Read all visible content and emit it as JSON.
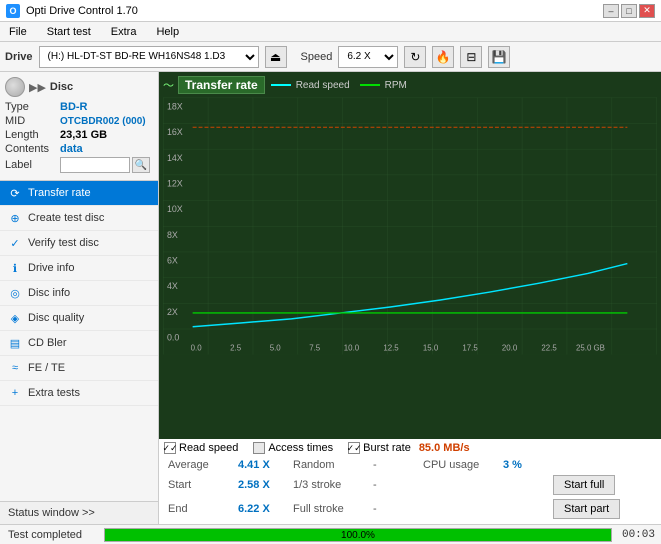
{
  "app": {
    "title": "Opti Drive Control 1.70",
    "icon": "O"
  },
  "title_controls": {
    "minimize": "–",
    "maximize": "□",
    "close": "✕"
  },
  "menu": {
    "items": [
      "File",
      "Start test",
      "Extra",
      "Help"
    ]
  },
  "toolbar": {
    "drive_label": "Drive",
    "drive_value": "(H:)  HL-DT-ST BD-RE  WH16NS48 1.D3",
    "speed_label": "Speed",
    "speed_value": "6.2 X"
  },
  "disc": {
    "section_label": "Disc",
    "type_label": "Type",
    "type_value": "BD-R",
    "mid_label": "MID",
    "mid_value": "OTCBDR002 (000)",
    "length_label": "Length",
    "length_value": "23,31 GB",
    "contents_label": "Contents",
    "contents_value": "data",
    "label_label": "Label",
    "label_placeholder": ""
  },
  "nav": {
    "items": [
      {
        "id": "transfer-rate",
        "label": "Transfer rate",
        "icon": "⟳",
        "active": true
      },
      {
        "id": "create-test-disc",
        "label": "Create test disc",
        "icon": "⊕"
      },
      {
        "id": "verify-test-disc",
        "label": "Verify test disc",
        "icon": "✓"
      },
      {
        "id": "drive-info",
        "label": "Drive info",
        "icon": "ℹ"
      },
      {
        "id": "disc-info",
        "label": "Disc info",
        "icon": "💿"
      },
      {
        "id": "disc-quality",
        "label": "Disc quality",
        "icon": "◈"
      },
      {
        "id": "cd-bler",
        "label": "CD Bler",
        "icon": "▤"
      },
      {
        "id": "fe-te",
        "label": "FE / TE",
        "icon": "≈"
      },
      {
        "id": "extra-tests",
        "label": "Extra tests",
        "icon": "+"
      }
    ],
    "status_window": "Status window >>"
  },
  "chart": {
    "title": "Transfer rate",
    "legend": {
      "read_speed_label": "Read speed",
      "rpm_label": "RPM"
    },
    "y_axis_labels": [
      "18X",
      "16X",
      "14X",
      "12X",
      "10X",
      "8X",
      "6X",
      "4X",
      "2X",
      "0.0"
    ],
    "x_axis_labels": [
      "0.0",
      "2.5",
      "5.0",
      "7.5",
      "10.0",
      "12.5",
      "15.0",
      "17.5",
      "20.0",
      "22.5",
      "25.0 GB"
    ],
    "checkboxes": {
      "read_speed": {
        "label": "Read speed",
        "checked": true
      },
      "access_times": {
        "label": "Access times",
        "checked": false
      },
      "burst_rate": {
        "label": "Burst rate",
        "checked": true,
        "value": "85.0 MB/s"
      }
    }
  },
  "stats": {
    "average_label": "Average",
    "average_value": "4.41 X",
    "random_label": "Random",
    "random_value": "-",
    "cpu_usage_label": "CPU usage",
    "cpu_usage_value": "3 %",
    "start_label": "Start",
    "start_value": "2.58 X",
    "stroke1_3_label": "1/3 stroke",
    "stroke1_3_value": "-",
    "start_full_btn": "Start full",
    "end_label": "End",
    "end_value": "6.22 X",
    "full_stroke_label": "Full stroke",
    "full_stroke_value": "-",
    "start_part_btn": "Start part"
  },
  "status_bar": {
    "text": "Test completed",
    "progress": 100,
    "progress_label": "100.0%",
    "time": "00:03"
  }
}
